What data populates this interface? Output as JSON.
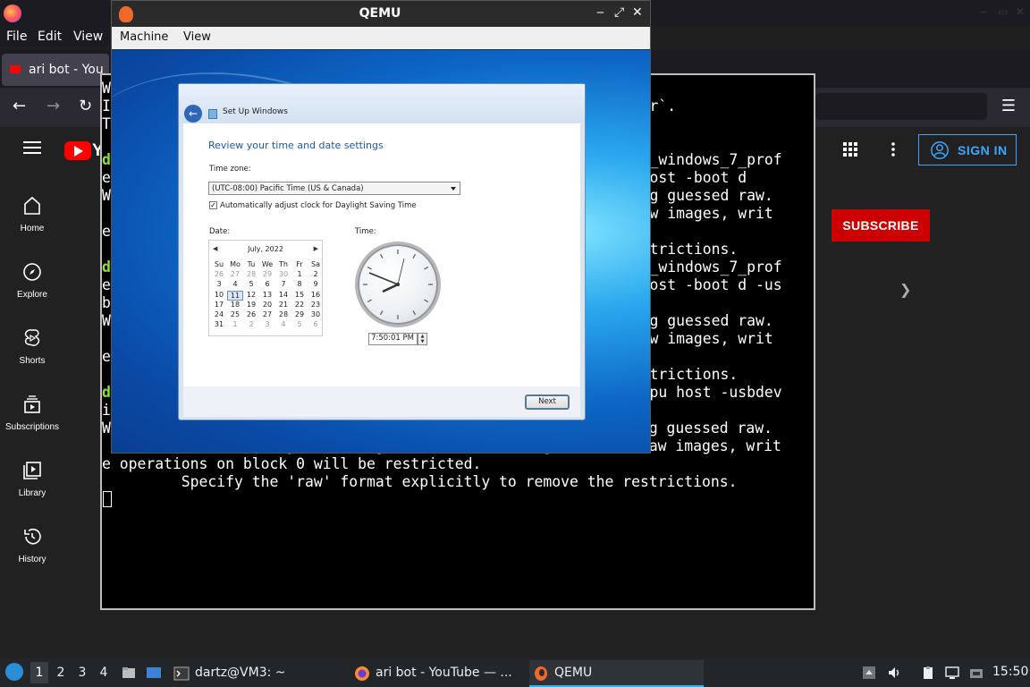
{
  "firefox": {
    "menu": [
      "File",
      "Edit",
      "View"
    ],
    "tab_title": "ari bot - You",
    "window_buttons": [
      "‒",
      "▭",
      "✕"
    ]
  },
  "youtube": {
    "logo_text": "Y",
    "nav": [
      {
        "label": "Home",
        "icon": "home-icon"
      },
      {
        "label": "Explore",
        "icon": "compass-icon"
      },
      {
        "label": "Shorts",
        "icon": "shorts-icon"
      },
      {
        "label": "Subscriptions",
        "icon": "subscriptions-icon"
      },
      {
        "label": "Library",
        "icon": "library-icon"
      },
      {
        "label": "History",
        "icon": "history-icon"
      }
    ],
    "sign_in": "SIGN IN",
    "subscribe": "SUBSCRIBE",
    "colors": {
      "red": "#cc0000",
      "blue": "#3ea6ff",
      "bg": "#212121"
    }
  },
  "terminal": {
    "lines": [
      {
        "row": 0,
        "text": "W"
      },
      {
        "row": 1,
        "text": "I",
        "right": "er`."
      },
      {
        "row": 2,
        "text": "T"
      },
      {
        "row": 4,
        "text": "d",
        "green": true,
        "right": "n_windows_7_prof"
      },
      {
        "row": 5,
        "text": "e",
        "right": "host -boot d"
      },
      {
        "row": 6,
        "text": "W",
        "right": "ng guessed raw."
      },
      {
        "row": 7,
        "right": "aw images, writ"
      },
      {
        "row": 8,
        "text": "e"
      },
      {
        "row": 9,
        "right": "strictions."
      },
      {
        "row": 10,
        "text": "d",
        "green": true,
        "right": "n_windows_7_prof"
      },
      {
        "row": 11,
        "text": "e",
        "right": "host -boot d -us"
      },
      {
        "row": 12,
        "text": "b"
      },
      {
        "row": 13,
        "text": "W",
        "right": "ng guessed raw."
      },
      {
        "row": 14,
        "right": "aw images, writ"
      },
      {
        "row": 15,
        "text": "e"
      },
      {
        "row": 16,
        "right": "strictions."
      },
      {
        "row": 17,
        "text": "d",
        "green": true,
        "right": "cpu host -usbdev"
      },
      {
        "row": 18,
        "text": "ice tablet"
      },
      {
        "row": 19,
        "text": "WARNING: Image format was not specified for '7.img' and probing guessed raw."
      },
      {
        "row": 20,
        "text": "         Automatically detecting the format is dangerous for raw images, writ"
      },
      {
        "row": 21,
        "text": "e operations on block 0 will be restricted."
      },
      {
        "row": 22,
        "text": "         Specify the 'raw' format explicitly to remove the restrictions."
      }
    ]
  },
  "qemu": {
    "title": "QEMU",
    "menu": [
      "Machine",
      "View"
    ],
    "window_buttons": [
      "‒",
      "⤢",
      "✕"
    ]
  },
  "setup": {
    "title": "Set Up Windows",
    "heading": "Review your time and date settings",
    "timezone_label": "Time zone:",
    "timezone_value": "(UTC-08:00) Pacific Time (US & Canada)",
    "dst_label": "Automatically adjust clock for Daylight Saving Time",
    "dst_checked": true,
    "date_label": "Date:",
    "time_label": "Time:",
    "calendar": {
      "month": "July, 2022",
      "weekdays": [
        "Su",
        "Mo",
        "Tu",
        "We",
        "Th",
        "Fr",
        "Sa"
      ],
      "weeks": [
        [
          "26",
          "27",
          "28",
          "29",
          "30",
          "1",
          "2"
        ],
        [
          "3",
          "4",
          "5",
          "6",
          "7",
          "8",
          "9"
        ],
        [
          "10",
          "11",
          "12",
          "13",
          "14",
          "15",
          "16"
        ],
        [
          "17",
          "18",
          "19",
          "20",
          "21",
          "22",
          "23"
        ],
        [
          "24",
          "25",
          "26",
          "27",
          "28",
          "29",
          "30"
        ],
        [
          "31",
          "1",
          "2",
          "3",
          "4",
          "5",
          "6"
        ]
      ],
      "selected": "11"
    },
    "time_value": "7:50:01 PM",
    "next_label": "Next"
  },
  "taskbar": {
    "workspaces": [
      "1",
      "2",
      "3",
      "4"
    ],
    "active_workspace": "1",
    "tasks": [
      {
        "label": "dartz@VM3: ~",
        "icon": "terminal-icon"
      },
      {
        "label": "ari bot - YouTube — ...",
        "icon": "firefox-icon"
      },
      {
        "label": "QEMU",
        "icon": "qemu-icon"
      }
    ],
    "clock": "15:50"
  }
}
